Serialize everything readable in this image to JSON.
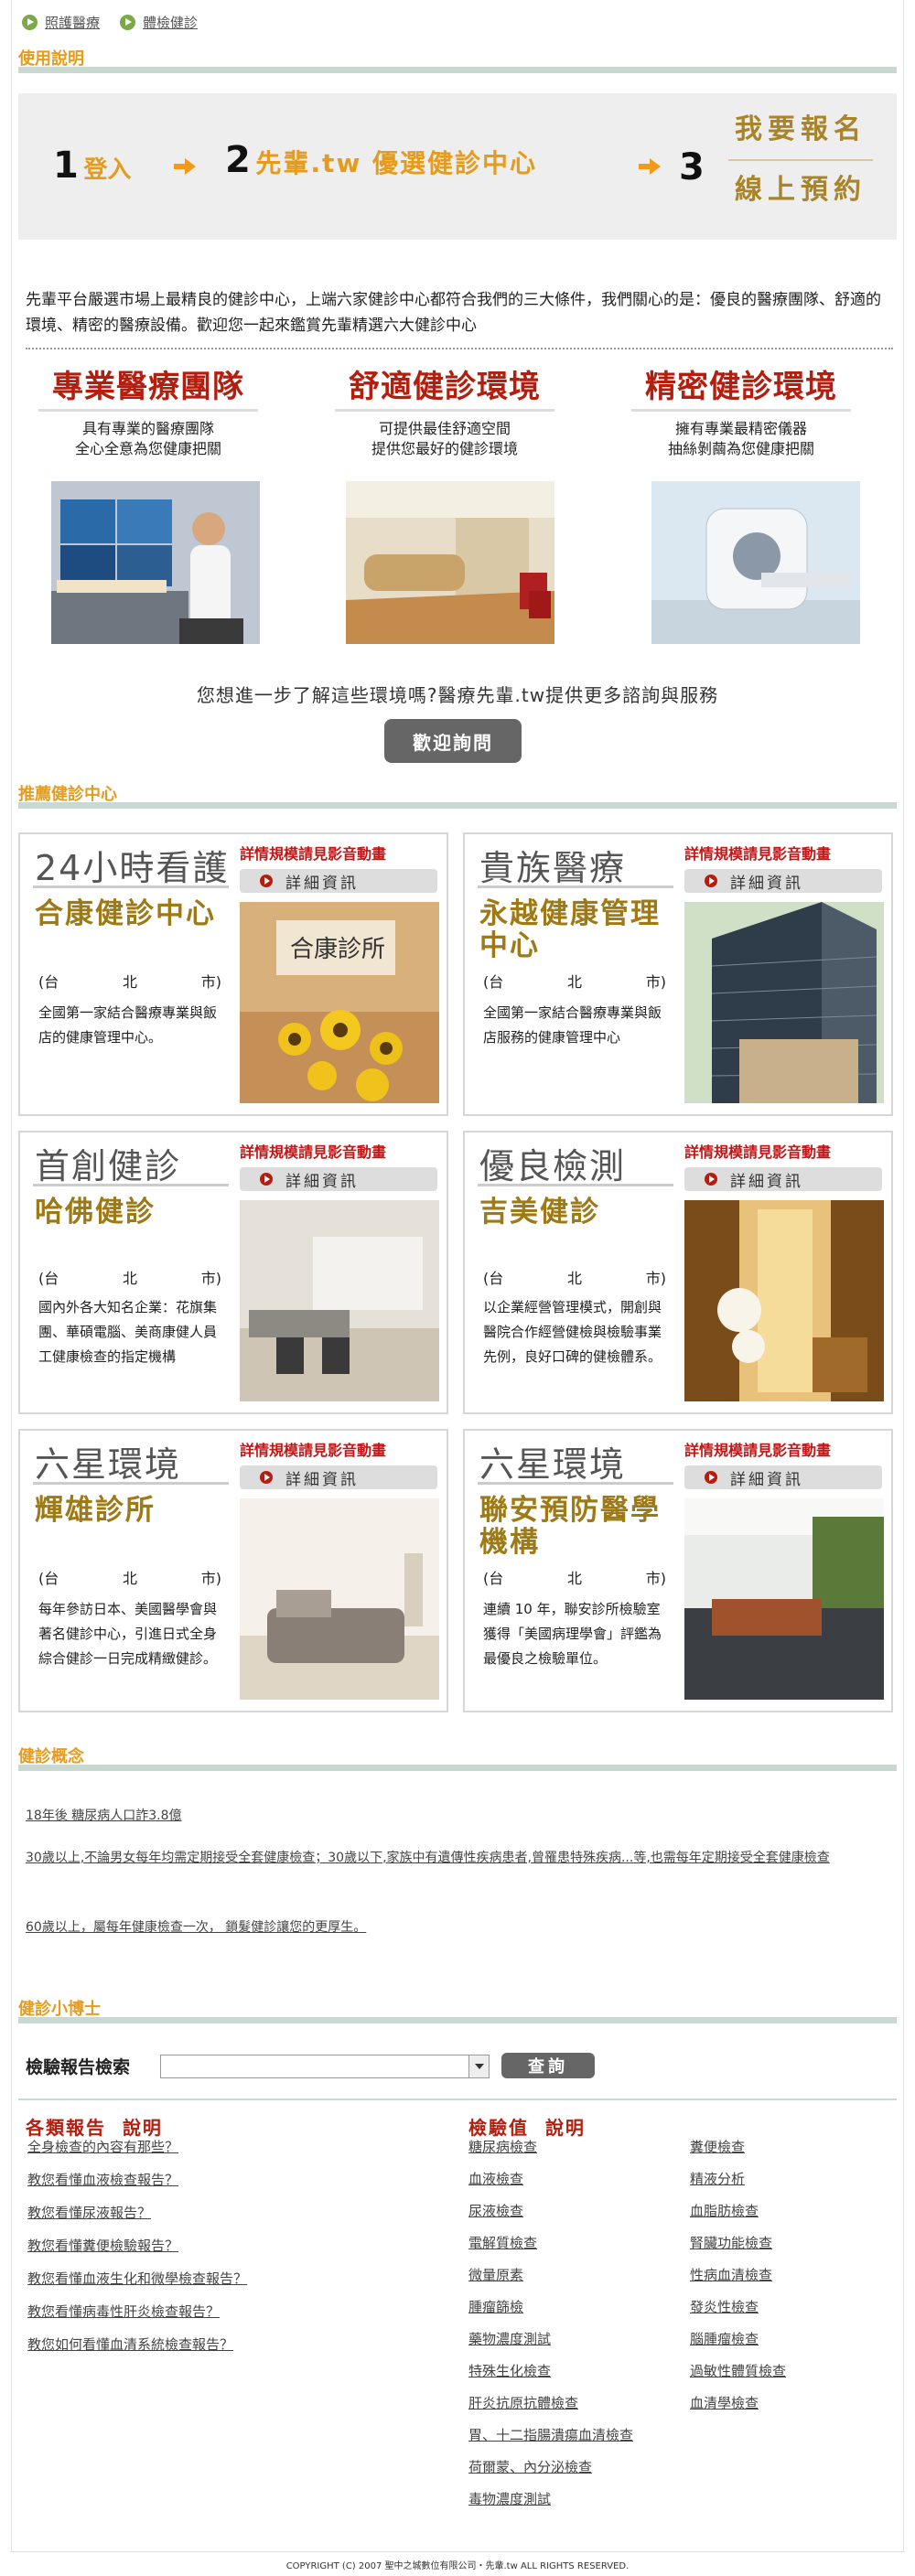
{
  "breadcrumb": [
    "照護醫療",
    "體檢健診"
  ],
  "usage": {
    "title": "使用說明"
  },
  "steps": {
    "s1_num": "1",
    "s1_label": "登入",
    "s2_num": "2",
    "s2_label": "先輩.tw 優選健診中心",
    "s3_num": "3",
    "s3_label_top": "我要報名",
    "s3_label_bottom": "線上預約"
  },
  "intro": "先輩平台嚴選市場上最精良的健診中心，上端六家健診中心都符合我們的三大條件，我們關心的是：優良的醫療團隊、舒適的環境、精密的醫療設備。歡迎您一起來鑑賞先輩精選六大健診中心",
  "features": [
    {
      "title": "專業醫療團隊",
      "line1": "具有專業的醫療團隊",
      "line2": "全心全意為您健康把關"
    },
    {
      "title": "舒適健診環境",
      "line1": "可提供最佳舒適空間",
      "line2": "提供您最好的健診環境"
    },
    {
      "title": "精密健診環境",
      "line1": "擁有專業最精密儀器",
      "line2": "抽絲剝繭為您健康把關"
    }
  ],
  "question": "您想進一步了解這些環境嗎?醫療先輩.tw提供更多諮詢與服務",
  "ask_button": "歡迎詢問",
  "recommend": {
    "title": "推薦健診中心"
  },
  "cards": [
    {
      "category": "24小時看護",
      "name": "合康健診中心",
      "city": [
        "(台",
        "北",
        "市)"
      ],
      "desc": "全國第一家結合醫療專業與飯店的健康管理中心。",
      "video": "詳情規模請見影音動畫",
      "detail": "詳細資訊",
      "sign": "合康診所"
    },
    {
      "category": "貴族醫療",
      "name": "永越健康管理中心",
      "city": [
        "(台",
        "北",
        "市)"
      ],
      "desc": "全國第一家結合醫療專業與飯店服務的健康管理中心",
      "video": "詳情規模請見影音動畫",
      "detail": "詳細資訊"
    },
    {
      "category": "首創健診",
      "name": "哈佛健診",
      "city": [
        "(台",
        "北",
        "市)"
      ],
      "desc": "國內外各大知名企業：花旗集團、華碩電腦、美商康健人員工健康檢查的指定機構",
      "video": "詳情規模請見影音動畫",
      "detail": "詳細資訊"
    },
    {
      "category": "優良檢測",
      "name": "吉美健診",
      "city": [
        "(台",
        "北",
        "市)"
      ],
      "desc": "以企業經營管理模式，開創與醫院合作經營健檢與檢驗事業先例，良好口碑的健檢體系。",
      "video": "詳情規模請見影音動畫",
      "detail": "詳細資訊"
    },
    {
      "category": "六星環境",
      "name": "輝雄診所",
      "city": [
        "(台",
        "北",
        "市)"
      ],
      "desc": "每年參訪日本、美國醫學會與著名健診中心，引進日式全身綜合健診一日完成精緻健診。",
      "video": "詳情規模請見影音動畫",
      "detail": "詳細資訊"
    },
    {
      "category": "六星環境",
      "name": "聯安預防醫學機構",
      "city": [
        "(台",
        "北",
        "市)"
      ],
      "desc": "連續 10 年，聯安診所檢驗室獲得「美國病理學會」評鑑為最優良之檢驗單位。",
      "video": "詳情規模請見影音動畫",
      "detail": "詳細資訊"
    }
  ],
  "concepts": {
    "title": "健診概念",
    "items": [
      "18年後 糖尿病人口詐3.8億",
      "30歲以上,不論男女每年均需定期接受全套健康檢查；30歲以下,家族中有遺傳性疾病患者,曾罹患特殊疾病...等,也需每年定期接受全套健康檢查",
      "60歲以上，屬每年健康檢查一次， 鎖髮健診讓您的更厚生。"
    ]
  },
  "tips": {
    "title": "健診小博士"
  },
  "search": {
    "label": "檢驗報告檢索",
    "button": "查詢"
  },
  "reports": {
    "title": "各類報告",
    "explain": "說明",
    "items": [
      "全身檢查的內容有那些？",
      "教您看懂血液檢查報告？",
      "教您看懂尿液報告？",
      "教您看懂糞便檢驗報告？",
      "教您看懂血液生化和微學檢查報告？",
      "教您看懂病毒性肝炎檢查報告？",
      "教您如何看懂血清系統檢查報告？"
    ]
  },
  "tests": {
    "title": "檢驗值",
    "explain": "說明",
    "col1": [
      "糖尿病檢查",
      "血液檢查",
      "尿液檢查",
      "電解質檢查",
      "微量原素",
      "腫瘤篩檢",
      "藥物濃度測試",
      "特殊生化檢查",
      "肝炎抗原抗體檢查",
      "胃、十二指腸潰瘍血清檢查",
      "荷爾蒙、內分泌檢查",
      "毒物濃度測試"
    ],
    "col2": [
      "糞便檢查",
      "精液分析",
      "血脂肪檢查",
      "腎臟功能檢查",
      "性病血清檢查",
      "發炎性檢查",
      "腦腫瘤檢查",
      "過敏性體質檢查",
      "血清學檢查"
    ]
  },
  "copyright": "COPYRIGHT (C) 2007 聖中之城數位有限公司・先輩.tw ALL RIGHTS RESERVED."
}
